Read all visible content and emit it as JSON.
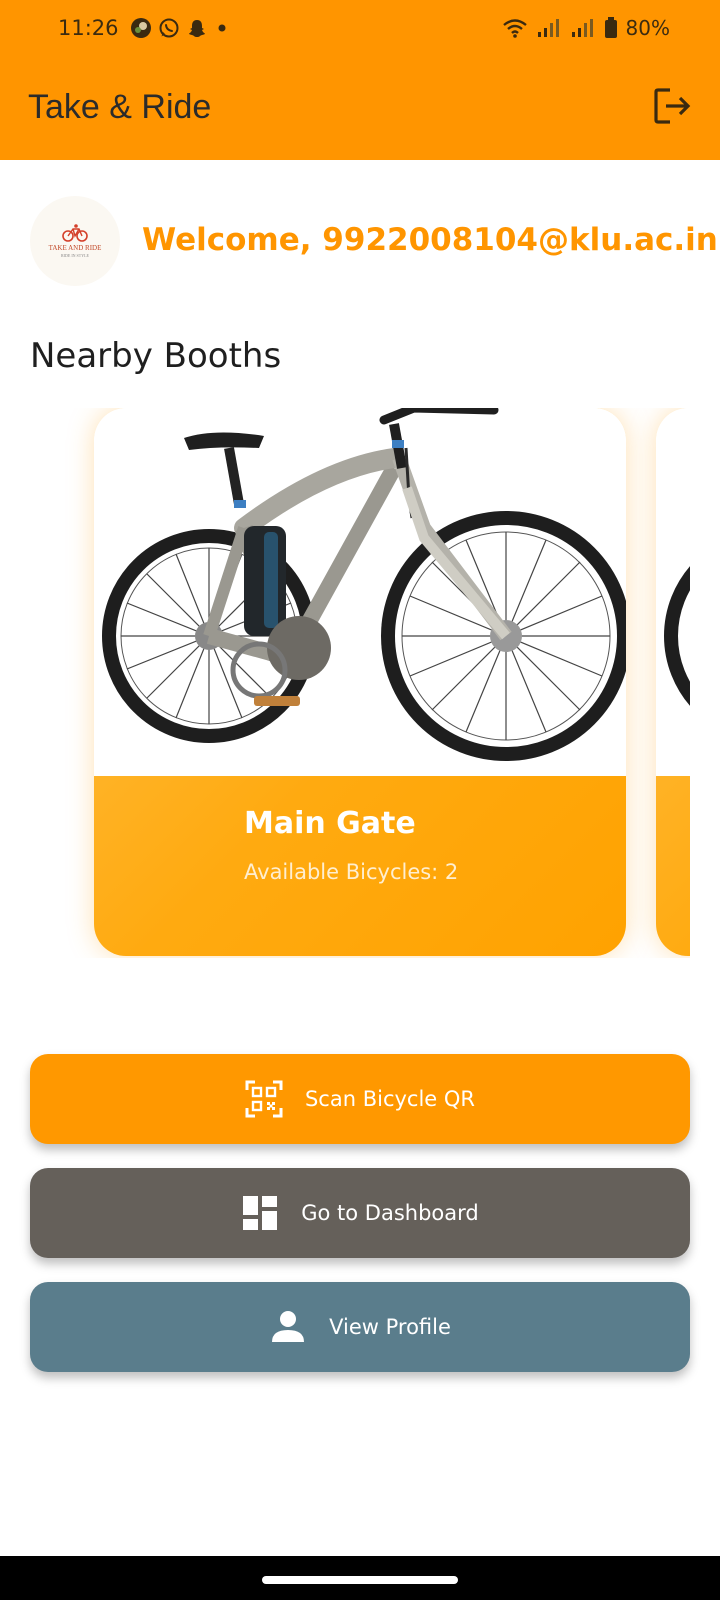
{
  "status_bar": {
    "time": "11:26",
    "battery": "80%",
    "notification_icons": [
      "photo-avatar-icon",
      "whatsapp-icon",
      "snapchat-icon",
      "dot-icon"
    ],
    "system_icons": [
      "wifi-icon",
      "signal-icon",
      "signal-icon",
      "battery-icon"
    ]
  },
  "app_bar": {
    "title": "Take & Ride",
    "logout_icon": "logout-icon"
  },
  "welcome": {
    "logo_text": "TAKE AND RIDE",
    "logo_subtext": "RIDE IN STYLE",
    "message": "Welcome, 9922008104@klu.ac.in"
  },
  "nearby": {
    "title": "Nearby Booths",
    "booths": [
      {
        "name": "Main Gate",
        "availability": "Available Bicycles: 2"
      }
    ]
  },
  "actions": {
    "scan_label": "Scan Bicycle QR",
    "dashboard_label": "Go to Dashboard",
    "profile_label": "View Profile"
  },
  "colors": {
    "primary": "#FF9500",
    "card": "#FFAA10",
    "dashboard": "#65605A",
    "profile": "#5A7D8C"
  }
}
